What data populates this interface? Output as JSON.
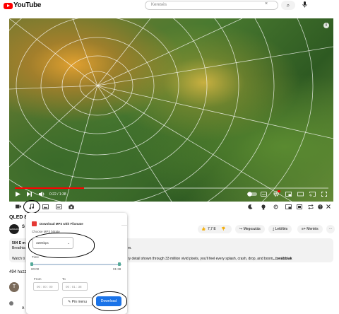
{
  "header": {
    "logo_text": "YouTube",
    "logo_region": "HU",
    "search_placeholder": "Keresés",
    "search_clear": "×",
    "search_icon": "⌕",
    "mic_icon": "🎤"
  },
  "player": {
    "time": "0:22 / 1:38",
    "progress": 0.22,
    "info_icon": "i"
  },
  "video": {
    "title": "QLED 8",
    "channel_initial": "S",
    "avatar_text": "SAMSUNG",
    "like_count": "7,7 E",
    "share_label": "Megosztás",
    "download_label": "Letöltés",
    "save_label": "Mentés",
    "views": "504 E m",
    "desc_line1": "Breathta",
    "desc_line1_end": "m.",
    "desc_line2_start": "Watch ti",
    "desc_line2": "ry detail shown through 33 million vivid pixels, you'll feel every splash, crash, drop, and boom.",
    "more": "...továbbiak",
    "comments": "494 hozz",
    "comment_avatar": "T",
    "comment_a": "A"
  },
  "popup": {
    "title": "Download MP3 with Flixmate",
    "choose_label": "Choose MP3 bitrate",
    "bitrate": "320Kbps",
    "time_label": "Time",
    "start_time": "00:00",
    "end_time": "01:38",
    "from_label": "From",
    "to_label": "To",
    "from_value": "00 : 00 : 00",
    "to_value": "00 : 01 : 38",
    "pin_label": "Pin menu",
    "download_label": "Download"
  }
}
